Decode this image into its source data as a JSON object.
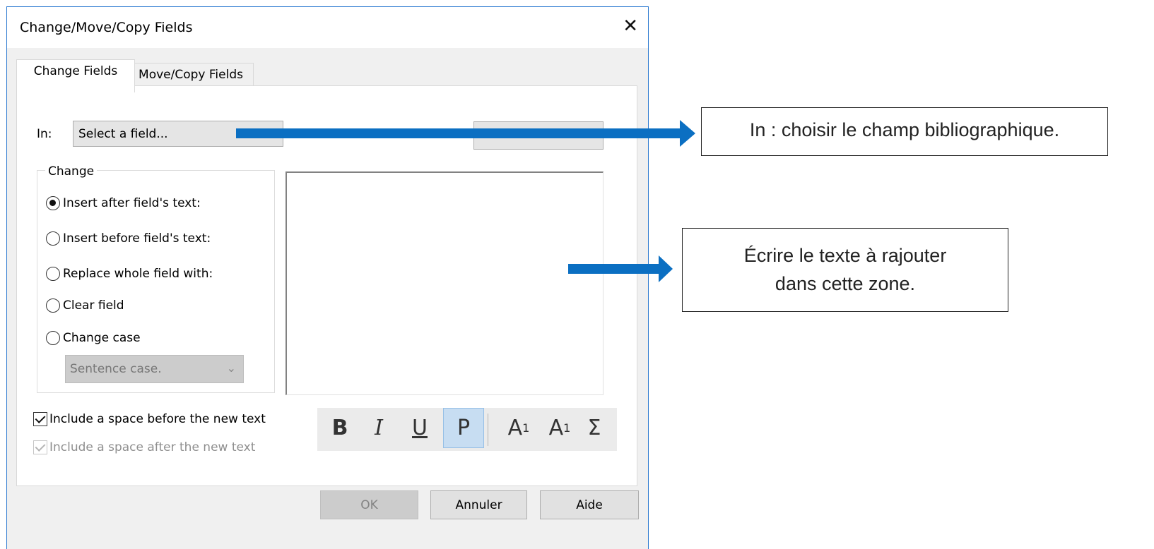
{
  "dialog": {
    "title": "Change/Move/Copy Fields",
    "close_glyph": "✕",
    "tabs": [
      {
        "label": "Change Fields",
        "active": true
      },
      {
        "label": "Move/Copy Fields",
        "active": false
      }
    ],
    "in_label": "In:",
    "field_select_value": "Select a field...",
    "change_group_label": "Change",
    "radio_options": [
      {
        "label": "Insert after field's text:",
        "checked": true
      },
      {
        "label": "Insert before field's text:",
        "checked": false
      },
      {
        "label": "Replace whole field with:",
        "checked": false
      },
      {
        "label": "Clear field",
        "checked": false
      },
      {
        "label": "Change case",
        "checked": false
      }
    ],
    "case_select_value": "Sentence case.",
    "checkboxes": [
      {
        "label": "Include a space before the new text",
        "checked": true,
        "enabled": true
      },
      {
        "label": "Include a space after the new text",
        "checked": true,
        "enabled": false
      }
    ],
    "format_buttons": {
      "bold": "B",
      "italic": "I",
      "underline": "U",
      "plain": "P",
      "superscript_base": "A",
      "superscript_mark": "1",
      "subscript_base": "A",
      "subscript_mark": "1",
      "symbol": "Σ"
    },
    "buttons": {
      "ok": "OK",
      "cancel": "Annuler",
      "help": "Aide"
    }
  },
  "annotations": {
    "callout_field": "In : choisir le champ bibliographique.",
    "callout_text_line1": "Écrire le texte à rajouter",
    "callout_text_line2": "dans cette zone.",
    "arrow_color": "#0b6fc2"
  }
}
